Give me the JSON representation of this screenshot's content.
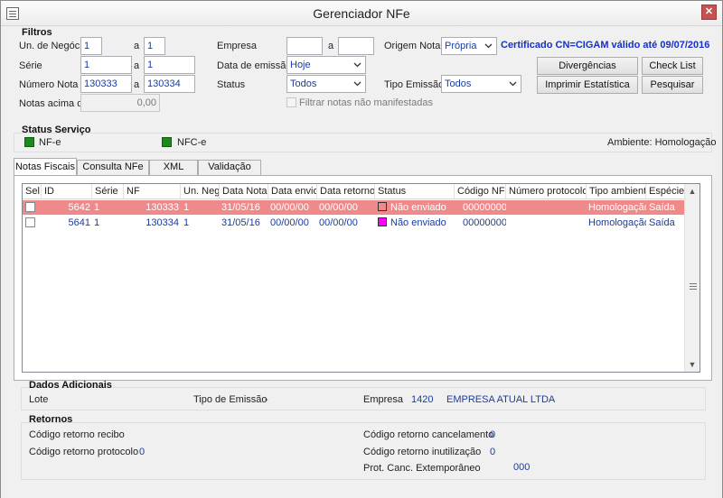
{
  "window": {
    "title": "Gerenciador NFe",
    "close_glyph": "✕"
  },
  "filters": {
    "title": "Filtros",
    "un_negocio": {
      "label": "Un. de Negócio",
      "from": "1",
      "sep": "a",
      "to": "1"
    },
    "serie": {
      "label": "Série",
      "from": "1",
      "sep": "a",
      "to": "1"
    },
    "numero_nota": {
      "label": "Número Nota",
      "from": "130333",
      "sep": "a",
      "to": "130334"
    },
    "notas_acima": {
      "label": "Notas acima de",
      "value": "0,00"
    },
    "empresa": {
      "label": "Empresa",
      "from": "",
      "sep": "a",
      "to": ""
    },
    "data_emissao": {
      "label": "Data de emissão",
      "value": "Hoje"
    },
    "status": {
      "label": "Status",
      "value": "Todos"
    },
    "filtrar_nao_manifestadas": {
      "label": "Filtrar notas não manifestadas"
    },
    "origem_nota": {
      "label": "Origem Nota",
      "value": "Própria"
    },
    "tipo_emissao": {
      "label": "Tipo Emissão",
      "value": "Todos"
    },
    "certificado": "Certificado CN=CIGAM válido até 09/07/2016",
    "buttons": {
      "divergencias": "Divergências",
      "check_list": "Check List",
      "imprimir_estatistica": "Imprimir Estatística",
      "pesquisar": "Pesquisar"
    }
  },
  "status_servico": {
    "title": "Status Serviço",
    "nfe": "NF-e",
    "nfce": "NFC-e",
    "ambiente": "Ambiente: Homologação",
    "indicator_color": "#1d8a1d"
  },
  "tabs": [
    {
      "label": "Notas Fiscais"
    },
    {
      "label": "Consulta NFe"
    },
    {
      "label": "XML"
    },
    {
      "label": "Validação XML"
    }
  ],
  "grid": {
    "columns": [
      "Sel",
      "ID",
      "Série",
      "NF",
      "Un. Neg.",
      "Data Nota",
      "Data envio",
      "Data retorno",
      "Status",
      "Código NFe",
      "Número protocolo",
      "Tipo ambiente",
      "Espécie"
    ],
    "rows": [
      {
        "id": "5642",
        "serie": "1",
        "nf": "130333",
        "un_neg": "1",
        "data_nota": "31/05/16",
        "data_envio": "00/00/00",
        "data_retorno": "00/00/00",
        "status": "Não enviado",
        "status_color": "#f08a8a",
        "codigo_nfe": "000000000",
        "numero_protocolo": "",
        "tipo_ambiente": "Homologação",
        "especie": "Saída"
      },
      {
        "id": "5641",
        "serie": "1",
        "nf": "130334",
        "un_neg": "1",
        "data_nota": "31/05/16",
        "data_envio": "00/00/00",
        "data_retorno": "00/00/00",
        "status": "Não enviado",
        "status_color": "#ff00ff",
        "codigo_nfe": "000000000",
        "numero_protocolo": "",
        "tipo_ambiente": "Homologação",
        "especie": "Saída"
      }
    ]
  },
  "dados_adicionais": {
    "title": "Dados Adicionais",
    "lote_label": "Lote",
    "tipo_emissao_label": "Tipo de Emissão",
    "tipo_emissao_value": "-",
    "empresa_label": "Empresa",
    "empresa_code": "1420",
    "empresa_name": "EMPRESA ATUAL LTDA"
  },
  "retornos": {
    "title": "Retornos",
    "recibo_label": "Código retorno recibo",
    "protocolo_label": "Código retorno protocolo",
    "protocolo_value": "0",
    "cancelamento_label": "Código retorno cancelamento",
    "cancelamento_value": "0",
    "inutilizacao_label": "Código retorno inutilização",
    "inutilizacao_value": "0",
    "canc_extemporaneo_label": "Prot. Canc. Extemporâneo",
    "canc_extemporaneo_value": "000"
  }
}
